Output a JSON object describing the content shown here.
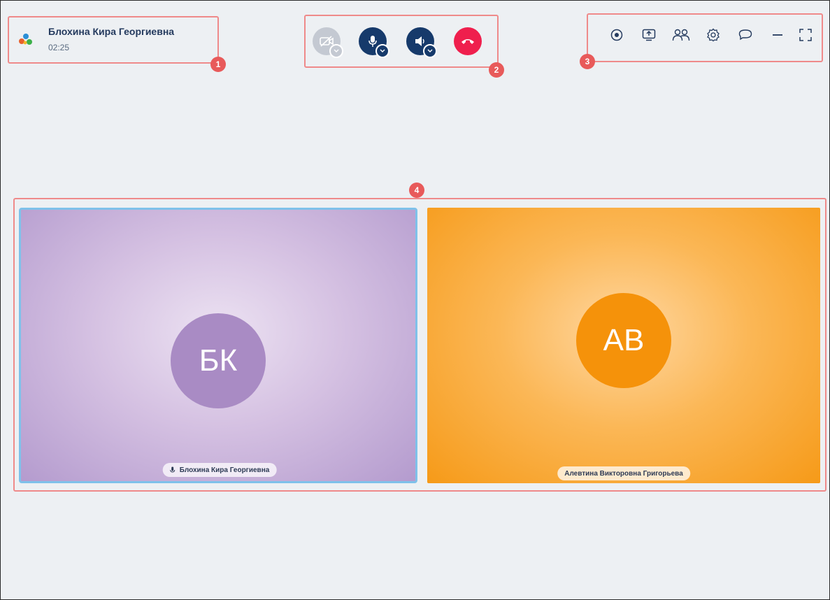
{
  "caller": {
    "name": "Блохина Кира Георгиевна",
    "timer": "02:25",
    "logo_icon": "app-logo-icon"
  },
  "controls": [
    {
      "id": "camera",
      "icon": "camera-off-icon",
      "state": "disabled",
      "color": "#c4c9d2"
    },
    {
      "id": "microphone",
      "icon": "microphone-icon",
      "state": "on",
      "color": "#163a6b"
    },
    {
      "id": "speaker",
      "icon": "speaker-icon",
      "state": "on",
      "color": "#163a6b"
    },
    {
      "id": "hangup",
      "icon": "phone-hangup-icon",
      "state": "active",
      "color": "#ef1f4d"
    }
  ],
  "toolbar": {
    "icons": [
      "record-icon",
      "screen-share-icon",
      "participants-icon",
      "settings-icon",
      "chat-icon",
      "minimize-icon",
      "fullscreen-icon"
    ]
  },
  "participants": [
    {
      "initials": "БК",
      "name": "Блохина Кира Георгиевна",
      "avatar_color": "#a98bc4",
      "speaking": true
    },
    {
      "initials": "АВ",
      "name": "Алевтина Викторовна Григорьева",
      "avatar_color": "#f5920a",
      "speaking": false
    }
  ],
  "callouts": {
    "m1": "1",
    "m2": "2",
    "m3": "3",
    "m4": "4"
  },
  "colors": {
    "background": "#edf0f3",
    "callout": "#ef8a8a",
    "marker": "#e85a5a",
    "navy": "#163a6b",
    "hangup": "#ef1f4d"
  }
}
